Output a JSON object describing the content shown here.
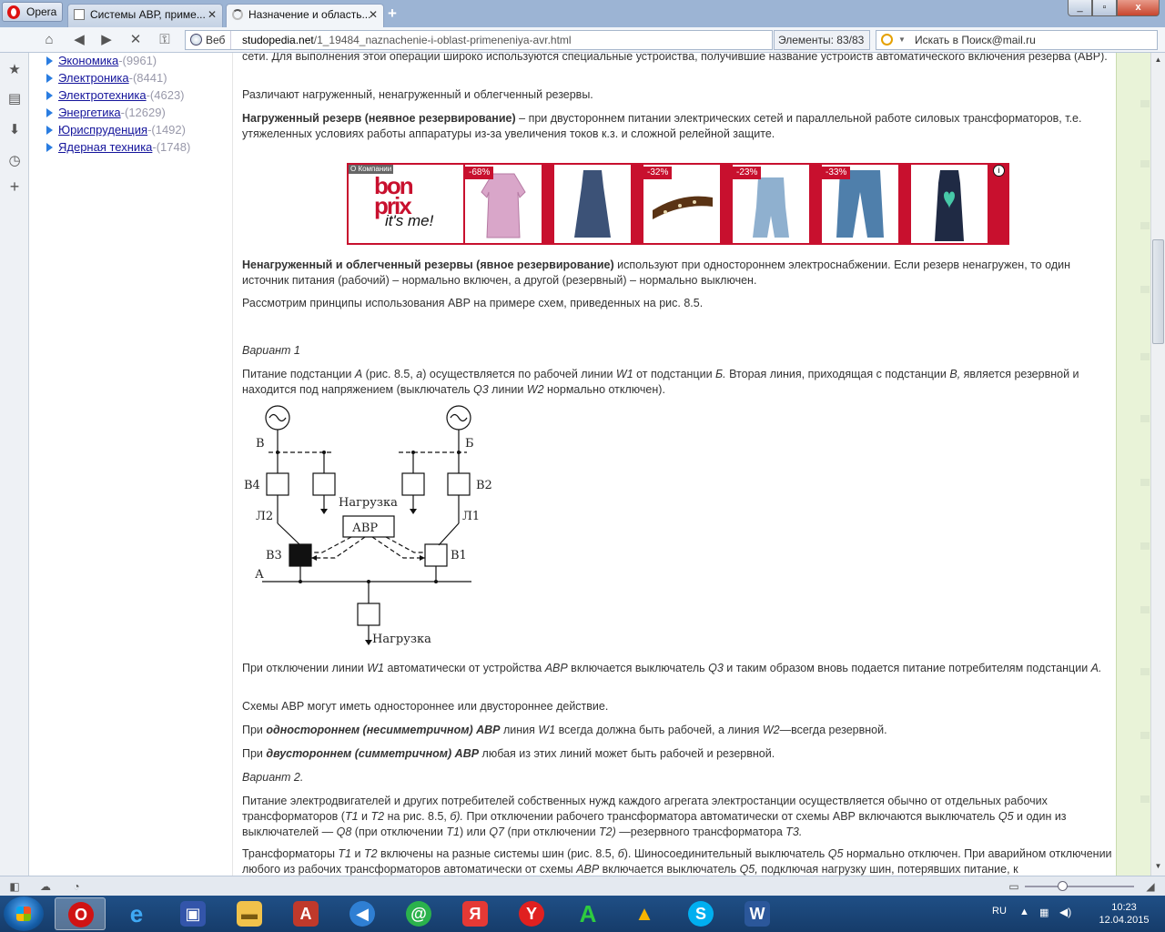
{
  "browser": {
    "menu_label": "Opera",
    "tabs": [
      {
        "title": "Системы АВР, приме..."
      },
      {
        "title": "Назначение и область..."
      }
    ],
    "new_tab": "+",
    "win_min": "_",
    "win_max": "▫",
    "win_close": "x",
    "address_badge": "Веб",
    "url_domain": "studopedia.net",
    "url_path": "/1_19484_naznachenie-i-oblast-primeneniya-avr.html",
    "elements_label": "Элементы:",
    "elements_count": "83/83",
    "search_placeholder": "Искать в Поиск@mail.ru"
  },
  "sidebar": {
    "items": [
      {
        "label": "Экономика",
        "count": "-(9961)"
      },
      {
        "label": "Электроника",
        "count": "-(8441)"
      },
      {
        "label": "Электротехника",
        "count": "-(4623)"
      },
      {
        "label": "Энергетика",
        "count": "-(12629)"
      },
      {
        "label": "Юриспруденция",
        "count": "-(1492)"
      },
      {
        "label": "Ядерная техника",
        "count": "-(1748)"
      }
    ]
  },
  "content": {
    "p0": "сети. Для выполнения этой операции широко используются специальные устройства, получившие название устройств автоматического включения резерва (АВР).",
    "p1": "Различают нагруженный, ненагруженный и облегченный резервы.",
    "p2_bold": "Нагруженный резерв (неявное резервирование)",
    "p2_rest": " – при двустороннем питании электрических сетей и параллельной работе силовых трансформаторов, т.е. утяжеленных условиях работы аппаратуры из-за увеличения токов к.з. и сложной релейной защите.",
    "p3_bold": "Ненагруженный и облегченный резервы (явное резервирование)",
    "p3_rest": " используют при одностороннем электроснабжении. Если резерв ненагружен, то один источник питания (рабочий) – нормально включен, а другой (резервный) – нормально выключен.",
    "p4": "Рассмотрим принципы использования АВР на примере схем, приведенных на рис. 8.5.",
    "v1": "Вариант 1",
    "p5": {
      "a": "Питание подстанции ",
      "b": "А",
      "c": " (рис. 8.5, ",
      "d": "а",
      "e": ") осуществляется по рабочей линии ",
      "f": "W1",
      "g": " от подстанции ",
      "h": "Б.",
      "i": " Вторая линия, приходящая с подстанции ",
      "j": "В,",
      "k": " является резервной и находится под напряжением (выключатель ",
      "l": "Q3",
      "m": " линии ",
      "n": "W2",
      "o": " нормально отключен)."
    },
    "p6": {
      "a": "При отключении линии ",
      "b": "W1",
      "c": " автоматически от устройства ",
      "d": "АВР",
      "e": " включается выключатель ",
      "f": "Q3",
      "g": " и таким образом вновь подается питание потребителям подстанции ",
      "h": "А."
    },
    "p7": "Схемы АВР могут иметь одностороннее или двустороннее действие.",
    "p8": {
      "a": "При ",
      "b": "одностороннем (несимметричном) АВР",
      "c": " линия ",
      "d": "W1",
      "e": " всегда должна быть рабочей, а линия ",
      "f": "W2",
      "g": "—всегда резервной."
    },
    "p9": {
      "a": "При ",
      "b": "двустороннем (симметричном) АВР",
      "c": " любая из этих линий может быть рабочей и резервной."
    },
    "v2": "Вариант 2.",
    "p10": {
      "a": "Питание электродвигателей и других потребителей собственных нужд каждого агрегата электростанции осуществляется обычно от отдельных рабочих трансформаторов (",
      "b": "Т1",
      "c": " и ",
      "d": "Т2",
      "e": " на рис. 8.5, ",
      "f": "б).",
      "g": " При отключении рабочего трансформатора автоматически от схемы АВР включаются выключатель ",
      "h": "Q5",
      "i": " и один из выключателей — ",
      "j": "Q8",
      "k": " (при отключении ",
      "l": "Т1",
      "m": ") или ",
      "n": "Q7",
      "o": " (при отключении ",
      "p": "Т2)",
      "q": " —резервного трансформатора ",
      "r": "Т3."
    },
    "p11": {
      "a": "Трансформаторы ",
      "b": "Т1",
      "c": " и ",
      "d": "Т2",
      "e": " включены на разные системы шин (рис. 8.5, ",
      "f": "б",
      "g": "). Шиносоединительный выключатель ",
      "h": "Q5",
      "i": " нормально отключен. При аварийном отключении любого из рабочих трансформаторов автоматически от схемы ",
      "j": "АВР",
      "k": " включается выключатель ",
      "l": "Q5,",
      "m": " подключая нагрузку шин, потерявших питание, к"
    }
  },
  "banner": {
    "about": "О Компании",
    "logo_line1": "bon",
    "logo_line2": "prix",
    "logo_line3": "it's me!",
    "discounts": [
      "-68%",
      "",
      "-32%",
      "-23%",
      "-33%",
      ""
    ],
    "info": "i"
  },
  "diagram": {
    "label_v": "В",
    "label_b": "Б",
    "label_v4": "В4",
    "label_v2": "В2",
    "label_l2": "Л2",
    "label_l1": "Л1",
    "label_v3": "В3",
    "label_v1": "В1",
    "label_a": "А",
    "label_load1": "Нагрузка",
    "label_load2": "Нагрузка",
    "label_avr": "АВР"
  },
  "taskbar": {
    "lang": "RU",
    "time": "10:23",
    "date": "12.04.2015"
  }
}
